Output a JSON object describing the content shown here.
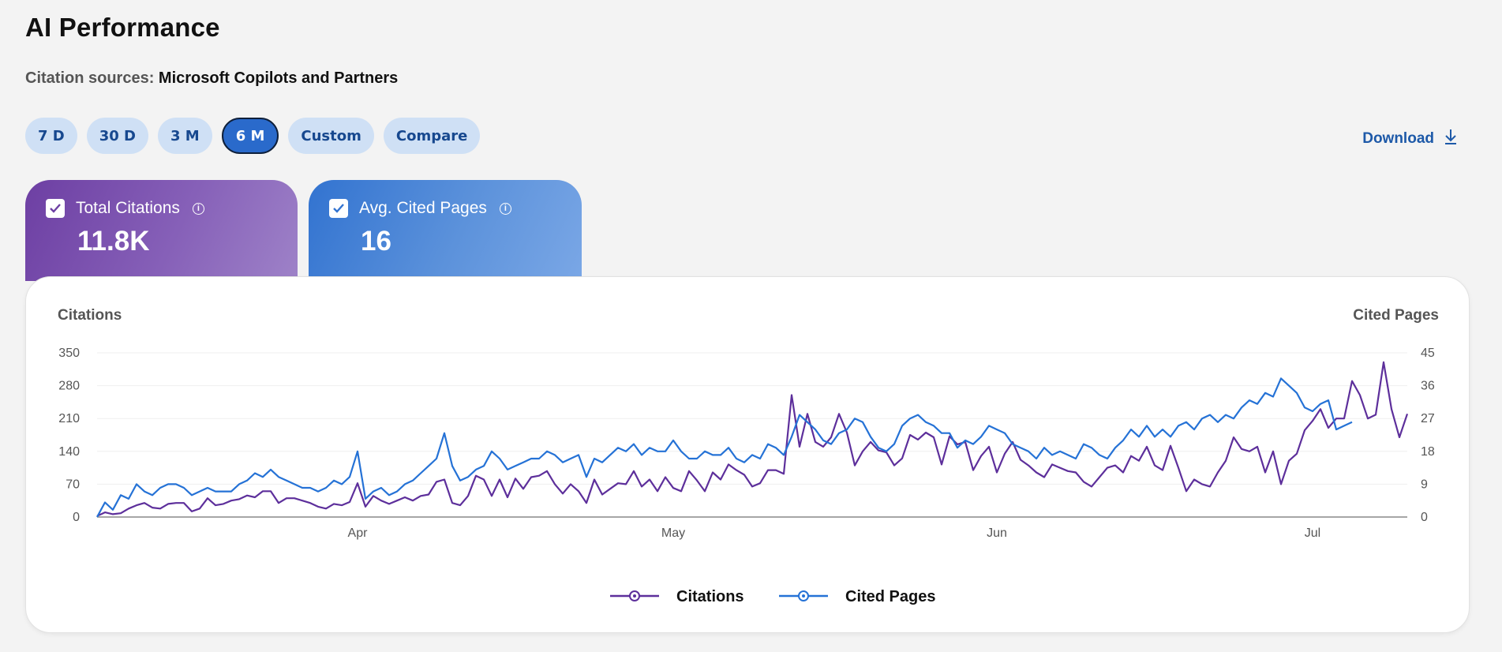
{
  "page": {
    "title": "AI Performance",
    "sources_label": "Citation sources:",
    "sources_value": "Microsoft Copilots and Partners"
  },
  "ranges": [
    {
      "label": "7 D",
      "active": false
    },
    {
      "label": "30 D",
      "active": false
    },
    {
      "label": "3 M",
      "active": false
    },
    {
      "label": "6 M",
      "active": true
    },
    {
      "label": "Custom",
      "active": false
    },
    {
      "label": "Compare",
      "active": false
    }
  ],
  "download": {
    "label": "Download",
    "icon": "download-icon"
  },
  "metrics": {
    "citations": {
      "label": "Total Citations",
      "value": "11.8K",
      "checked": true,
      "color": "#6d3fa3"
    },
    "pages": {
      "label": "Avg. Cited Pages",
      "value": "16",
      "checked": true,
      "color": "#3273d0"
    }
  },
  "chart_data": {
    "type": "line",
    "left_axis_label": "Citations",
    "right_axis_label": "Cited Pages",
    "left_ticks": [
      "0",
      "70",
      "140",
      "210",
      "280",
      "350"
    ],
    "right_ticks": [
      "0",
      "9",
      "18",
      "27",
      "36",
      "45"
    ],
    "left_ylim": [
      0,
      350
    ],
    "right_ylim": [
      0,
      45
    ],
    "x_labels": [
      {
        "label": "Apr",
        "index": 33
      },
      {
        "label": "May",
        "index": 73
      },
      {
        "label": "Jun",
        "index": 114
      },
      {
        "label": "Jul",
        "index": 154
      }
    ],
    "grid": true,
    "legend_position": "bottom-center",
    "series": [
      {
        "name": "Citations",
        "axis": "left",
        "color": "#5d2f9b",
        "values": [
          2,
          10,
          6,
          8,
          18,
          25,
          30,
          20,
          18,
          28,
          30,
          30,
          12,
          18,
          40,
          25,
          28,
          35,
          38,
          46,
          42,
          55,
          55,
          30,
          40,
          40,
          35,
          30,
          22,
          18,
          28,
          25,
          32,
          72,
          22,
          45,
          35,
          28,
          35,
          42,
          35,
          45,
          48,
          75,
          80,
          30,
          25,
          45,
          88,
          80,
          45,
          80,
          42,
          82,
          60,
          85,
          88,
          98,
          70,
          50,
          70,
          55,
          30,
          80,
          48,
          60,
          72,
          70,
          98,
          65,
          80,
          55,
          85,
          62,
          55,
          98,
          78,
          55,
          95,
          80,
          112,
          100,
          90,
          65,
          72,
          100,
          100,
          92,
          260,
          150,
          220,
          160,
          150,
          170,
          220,
          180,
          110,
          140,
          160,
          142,
          138,
          110,
          125,
          175,
          165,
          180,
          170,
          112,
          172,
          155,
          160,
          100,
          130,
          150,
          95,
          135,
          160,
          122,
          110,
          95,
          85,
          112,
          105,
          98,
          95,
          75,
          65,
          85,
          105,
          110,
          95,
          130,
          120,
          150,
          110,
          100,
          152,
          105,
          55,
          80,
          70,
          65,
          95,
          120,
          170,
          145,
          140,
          150,
          95,
          140,
          70,
          120,
          135,
          185,
          205,
          230,
          190,
          210,
          210,
          290,
          260,
          210,
          218,
          330,
          230,
          170,
          220
        ]
      },
      {
        "name": "Cited Pages",
        "axis": "right",
        "color": "#2572d6",
        "values": [
          0,
          4,
          2,
          6,
          5,
          9,
          7,
          6,
          8,
          9,
          9,
          8,
          6,
          7,
          8,
          7,
          7,
          7,
          9,
          10,
          12,
          11,
          13,
          11,
          10,
          9,
          8,
          8,
          7,
          8,
          10,
          9,
          11,
          18,
          5,
          7,
          8,
          6,
          7,
          9,
          10,
          12,
          14,
          16,
          23,
          14,
          10,
          11,
          13,
          14,
          18,
          16,
          13,
          14,
          15,
          16,
          16,
          18,
          17,
          15,
          16,
          17,
          11,
          16,
          15,
          17,
          19,
          18,
          20,
          17,
          19,
          18,
          18,
          21,
          18,
          16,
          16,
          18,
          17,
          17,
          19,
          16,
          15,
          17,
          16,
          20,
          19,
          17,
          22,
          28,
          26,
          24,
          21,
          20,
          23,
          24,
          27,
          26,
          22,
          19,
          18,
          20,
          25,
          27,
          28,
          26,
          25,
          23,
          23,
          19,
          21,
          20,
          22,
          25,
          24,
          23,
          20,
          19,
          18,
          16,
          19,
          17,
          18,
          17,
          16,
          20,
          19,
          17,
          16,
          19,
          21,
          24,
          22,
          25,
          22,
          24,
          22,
          25,
          26,
          24,
          27,
          28,
          26,
          28,
          27,
          30,
          32,
          31,
          34,
          33,
          38,
          36,
          34,
          30,
          29,
          31,
          32,
          24,
          25,
          26
        ]
      }
    ]
  }
}
